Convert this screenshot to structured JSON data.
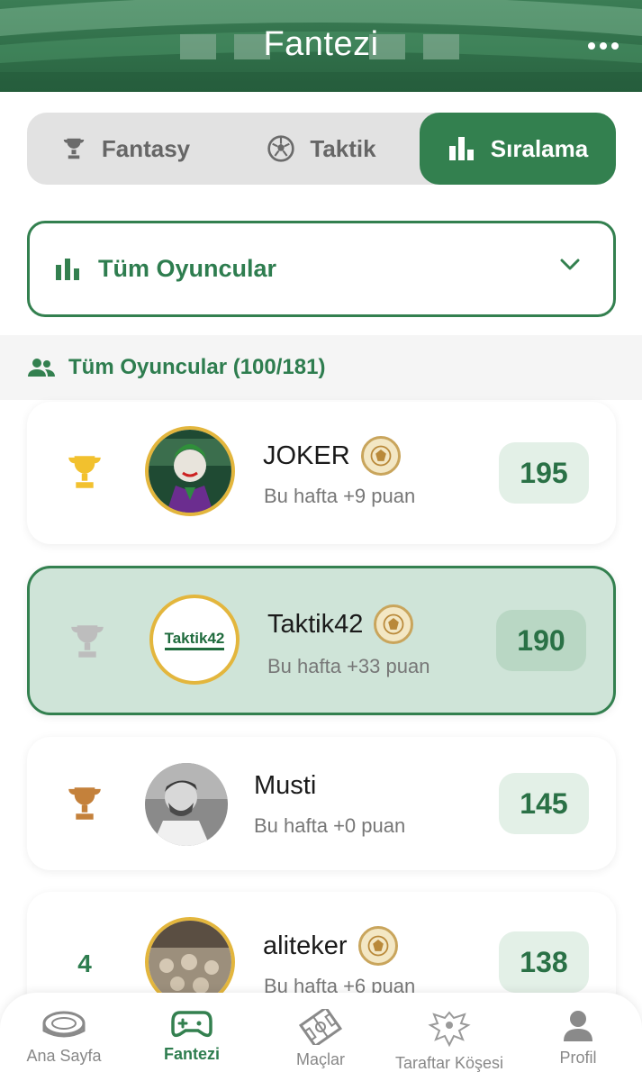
{
  "header": {
    "title": "Fantezi",
    "more_icon": "more-horizontal-icon"
  },
  "tabs": [
    {
      "label": "Fantasy",
      "icon": "trophy-icon",
      "active": false
    },
    {
      "label": "Taktik",
      "icon": "soccer-ball-icon",
      "active": false
    },
    {
      "label": "Sıralama",
      "icon": "bar-chart-icon",
      "active": true
    }
  ],
  "filter": {
    "selected": "Tüm Oyuncular",
    "icon": "bar-chart-icon"
  },
  "section": {
    "title": "Tüm Oyuncular (100/181)",
    "icon": "users-icon"
  },
  "players": [
    {
      "rank": "",
      "rank_icon": "gold-trophy-icon",
      "name": "JOKER",
      "weekly": "Bu hafta +9 puan",
      "points": "195",
      "highlight": false
    },
    {
      "rank": "",
      "rank_icon": "silver-trophy-icon",
      "name": "Taktik42",
      "avatar_text": "Taktik42",
      "weekly": "Bu hafta +33 puan",
      "points": "190",
      "highlight": true
    },
    {
      "rank": "",
      "rank_icon": "bronze-trophy-icon",
      "name": "Musti",
      "weekly": "Bu hafta +0 puan",
      "points": "145",
      "highlight": false
    },
    {
      "rank": "4",
      "name": "aliteker",
      "weekly": "Bu hafta +6 puan",
      "points": "138",
      "highlight": false
    }
  ],
  "bottom_nav": [
    {
      "label": "Ana Sayfa",
      "icon": "stadium-icon",
      "active": false
    },
    {
      "label": "Fantezi",
      "icon": "gamepad-icon",
      "active": true
    },
    {
      "label": "Maçlar",
      "icon": "pitch-icon",
      "active": false
    },
    {
      "label": "Taraftar Köşesi",
      "icon": "eagle-crest-icon",
      "active": false
    },
    {
      "label": "Profil",
      "icon": "person-icon",
      "active": false
    }
  ],
  "colors": {
    "primary": "#33804f",
    "gold": "#f2c12e",
    "silver": "#c9c9c9",
    "bronze": "#c4813b"
  }
}
